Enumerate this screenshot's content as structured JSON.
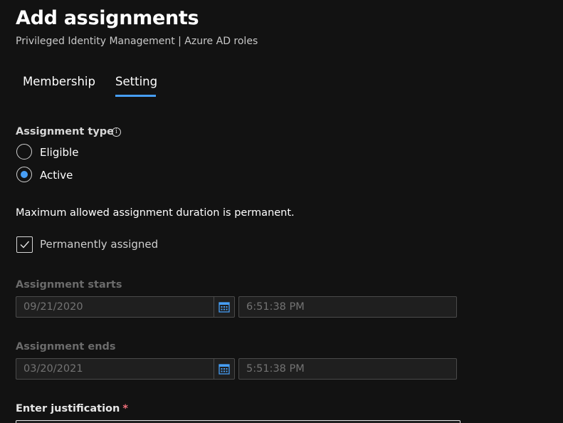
{
  "header": {
    "title": "Add assignments",
    "subtitle": "Privileged Identity Management | Azure AD roles"
  },
  "tabs": [
    {
      "label": "Membership",
      "selected": false
    },
    {
      "label": "Setting",
      "selected": true
    }
  ],
  "assignment_type": {
    "label": "Assignment type",
    "info_icon": "info-icon",
    "options": [
      {
        "label": "Eligible",
        "selected": false
      },
      {
        "label": "Active",
        "selected": true
      }
    ]
  },
  "notice": "Maximum allowed assignment duration is permanent.",
  "permanent": {
    "label": "Permanently assigned",
    "checked": true
  },
  "starts": {
    "label": "Assignment starts",
    "date": "09/21/2020",
    "time": "6:51:38 PM",
    "icon": "calendar-icon"
  },
  "ends": {
    "label": "Assignment ends",
    "date": "03/20/2021",
    "time": "5:51:38 PM",
    "icon": "calendar-icon"
  },
  "justification": {
    "label": "Enter justification",
    "required_marker": "*",
    "value": ""
  },
  "colors": {
    "background": "#121212",
    "accent": "#479ef5",
    "required": "#f1707b",
    "disabled_text": "#737373"
  }
}
